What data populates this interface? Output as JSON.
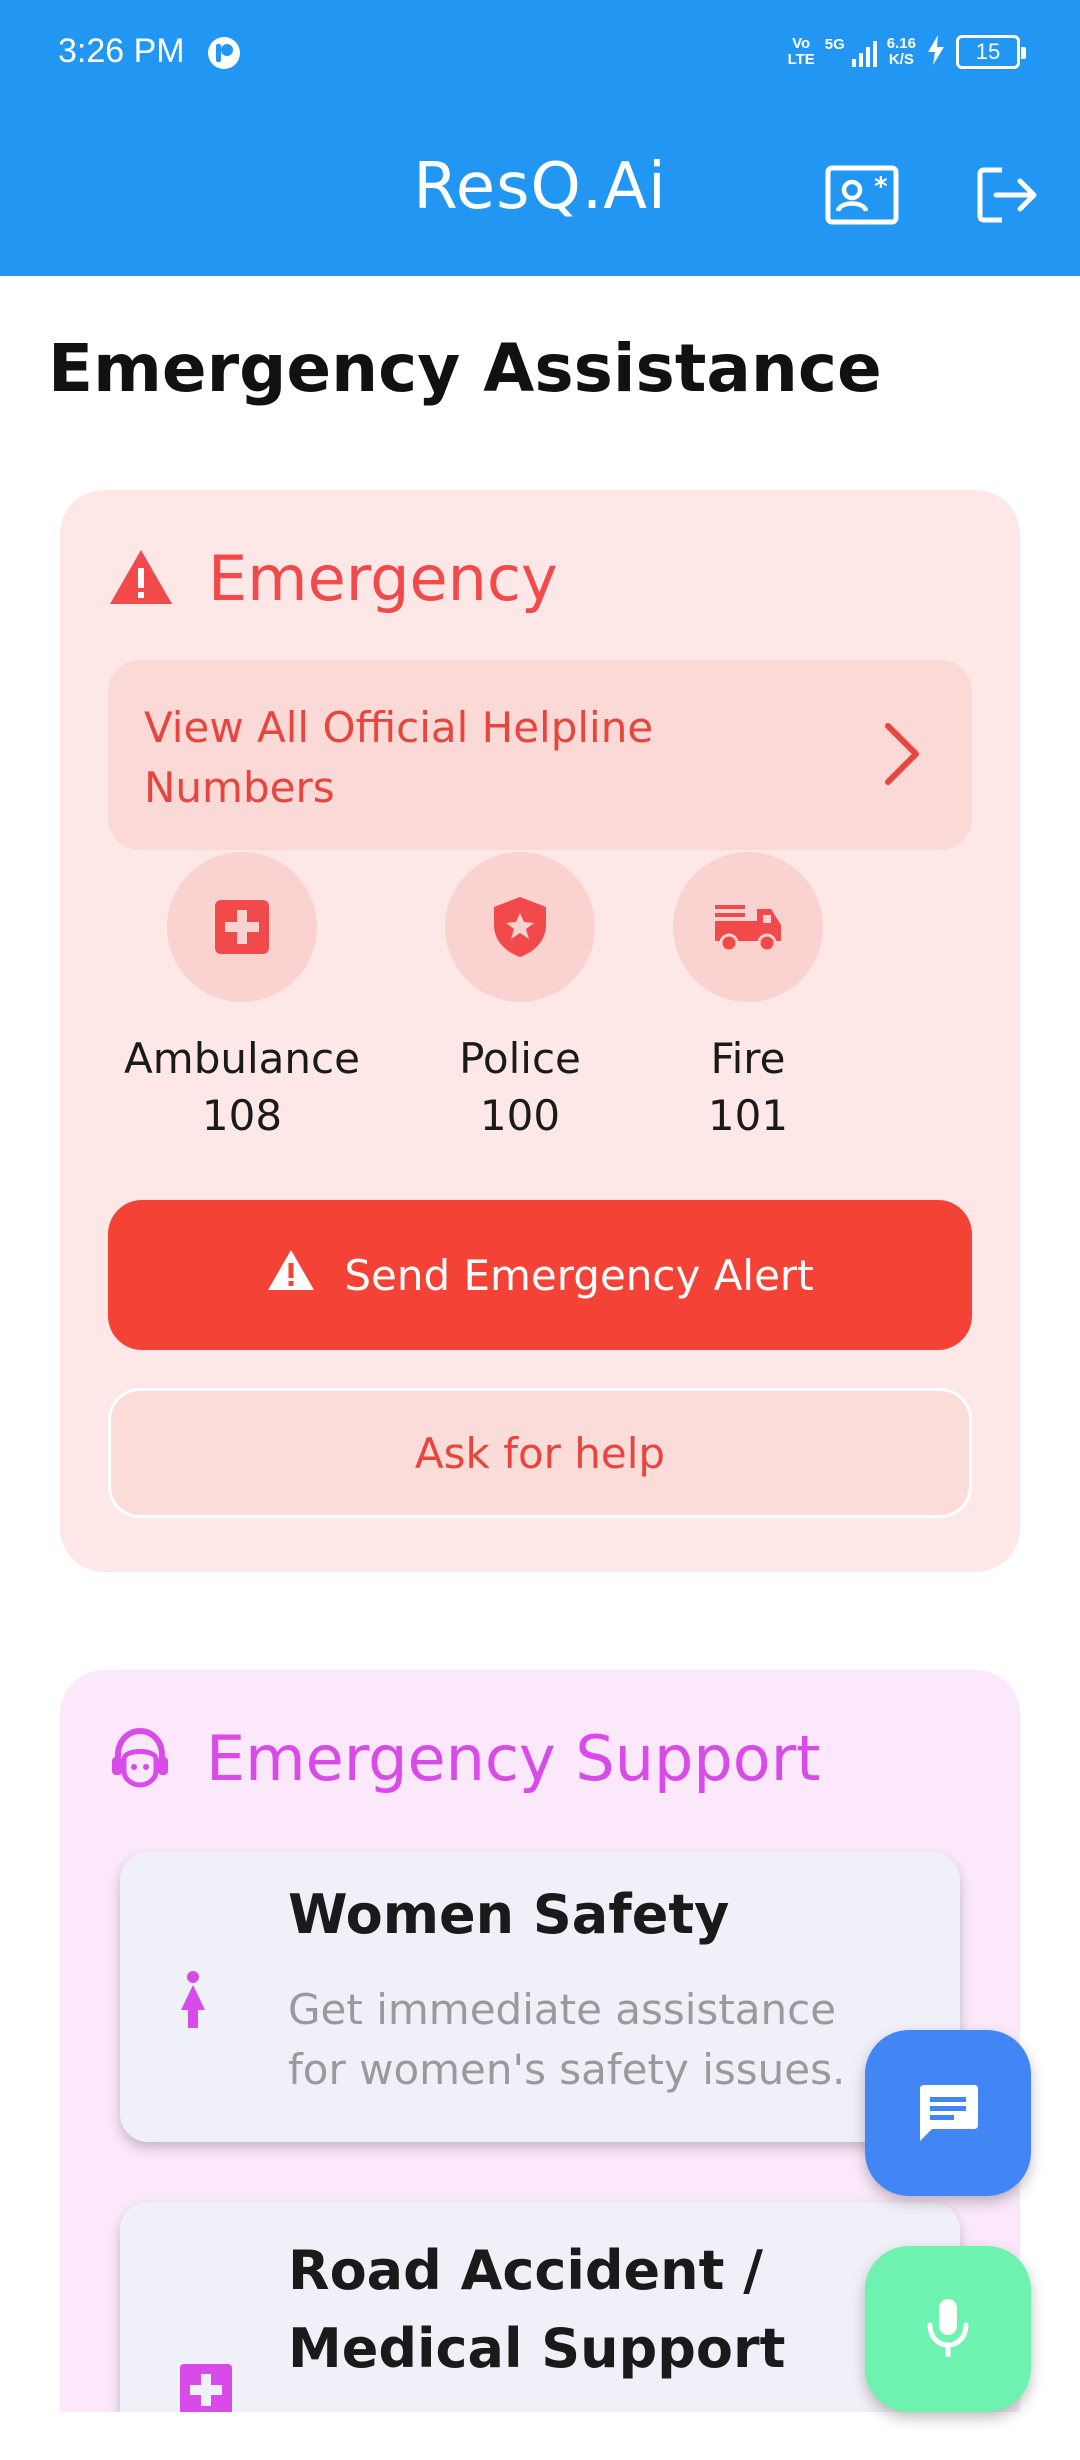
{
  "status_bar": {
    "time": "3:26 PM",
    "network_volte": "Vo\nLTE",
    "network_5g": "5G",
    "speed": "6.16\nK/S",
    "battery": "15"
  },
  "app_bar": {
    "title": "ResQ.Ai",
    "profile_icon": "contact-card-icon",
    "logout_icon": "logout-icon"
  },
  "page": {
    "title": "Emergency Assistance"
  },
  "emergency": {
    "heading": "Emergency",
    "helpline_link": "View All Official Helpline Numbers",
    "services": [
      {
        "name": "Ambulance",
        "number": "108",
        "icon": "medical-cross-icon"
      },
      {
        "name": "Police",
        "number": "100",
        "icon": "police-shield-icon"
      },
      {
        "name": "Fire",
        "number": "101",
        "icon": "fire-truck-icon"
      }
    ],
    "alert_button": "Send Emergency Alert",
    "help_button": "Ask for help"
  },
  "support": {
    "heading": "Emergency Support",
    "items": [
      {
        "title": "Women Safety",
        "description": "Get immediate assistance for women's safety issues."
      },
      {
        "title": "Road Accident / Medical Support",
        "description": ""
      }
    ]
  },
  "colors": {
    "primary": "#2196F3",
    "emergency_red": "#F44336",
    "emergency_bg": "#FDE8E7",
    "support_purple": "#D84BE8",
    "support_bg": "#FBE9FB",
    "chat_fab": "#4285F4",
    "mic_fab": "#6EF2B0"
  }
}
